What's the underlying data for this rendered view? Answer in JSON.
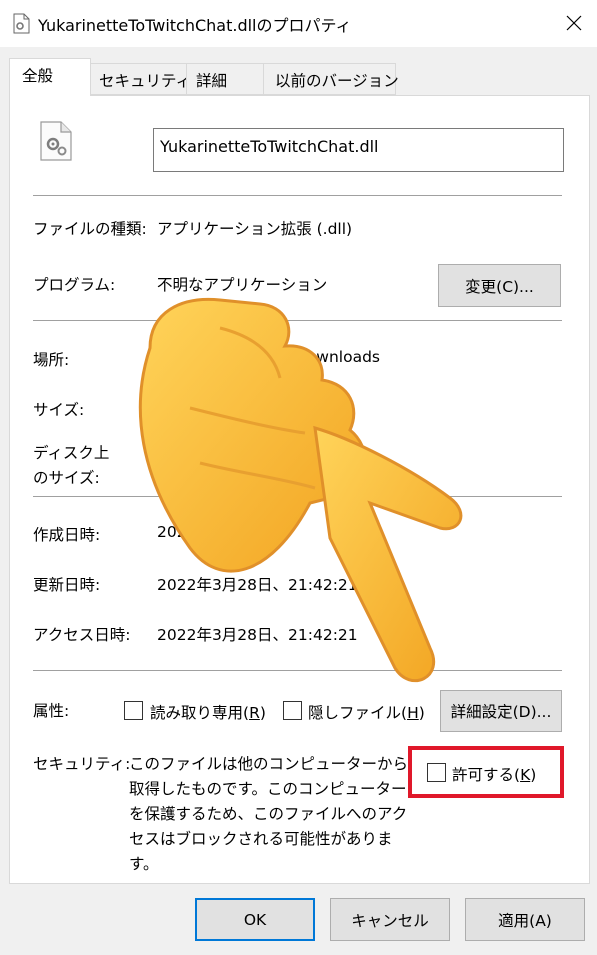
{
  "window": {
    "title": "YukarinetteToTwitchChat.dllのプロパティ",
    "app_icon": "document-gear-icon",
    "close_icon": "close-icon"
  },
  "tabs": [
    {
      "label": "全般",
      "active": true
    },
    {
      "label": "セキュリティ",
      "active": false
    },
    {
      "label": "詳細",
      "active": false
    },
    {
      "label": "以前のバージョン",
      "active": false
    }
  ],
  "file": {
    "icon": "dll-file-gear-icon",
    "name": "YukarinetteToTwitchChat.dll"
  },
  "props": {
    "type_label": "ファイルの種類:",
    "type_value": "アプリケーション拡張 (.dll)",
    "program_label": "プログラム:",
    "program_value": "不明なアプリケーション",
    "change_button": "変更(C)...",
    "location_label": "場所:",
    "location_value": "¥Downloads",
    "size_label": "サイズ:",
    "disk_size_label_1": "ディスク上",
    "disk_size_label_2": "のサイズ:",
    "created_label": "作成日時:",
    "created_value": "2022",
    "modified_label": "更新日時:",
    "modified_value": "2022年3月28日、21:42:21",
    "accessed_label": "アクセス日時:",
    "accessed_value": "2022年3月28日、21:42:21"
  },
  "attributes": {
    "label": "属性:",
    "readonly": {
      "text": "読み取り専用(",
      "key": "R",
      "close": ")",
      "checked": false
    },
    "hidden": {
      "text": "隠しファイル(",
      "key": "H",
      "close": ")",
      "checked": false
    },
    "advanced_button": "詳細設定(D)..."
  },
  "security": {
    "label": "セキュリティ:",
    "message": "このファイルは他のコンピューターから取得したものです。このコンピューターを保護するため、このファイルへのアクセスはブロックされる可能性があります。",
    "allow": {
      "text": "許可する(",
      "key": "K",
      "close": ")",
      "checked": false
    }
  },
  "footer": {
    "ok": "OK",
    "cancel": "キャンセル",
    "apply": "適用(A)"
  },
  "colors": {
    "highlight": "#e0182a",
    "default_button_border": "#0078d7"
  },
  "overlay": {
    "icon": "pointing-hand-emoji-icon"
  }
}
